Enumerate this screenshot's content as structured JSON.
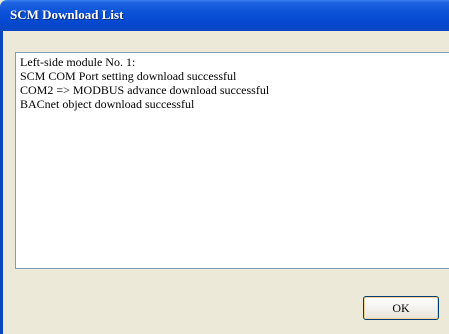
{
  "window": {
    "title": "SCM Download List"
  },
  "log": {
    "lines": [
      "Left-side module No. 1:",
      "SCM COM Port setting download successful",
      "COM2 => MODBUS advance download successful",
      "BACnet object download successful"
    ]
  },
  "buttons": {
    "ok_label": "OK"
  },
  "colors": {
    "titlebar": "#0548cf",
    "dialog_background": "#ece9d8",
    "textarea_border": "#7f9db9"
  }
}
